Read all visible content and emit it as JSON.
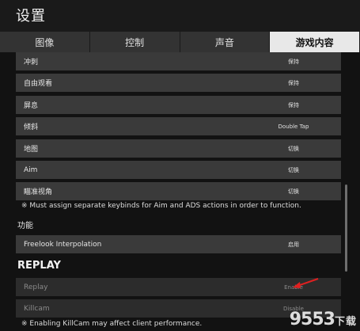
{
  "window": {
    "title": "设置"
  },
  "tabs": [
    {
      "label": "图像",
      "active": false
    },
    {
      "label": "控制",
      "active": false
    },
    {
      "label": "声音",
      "active": false
    },
    {
      "label": "游戏内容",
      "active": true
    }
  ],
  "rows": [
    {
      "label": "冲刺",
      "value": "保持"
    },
    {
      "label": "自由观看",
      "value": "保持"
    },
    {
      "label": "屏息",
      "value": "保持"
    },
    {
      "label": "倾斜",
      "value": "Double Tap"
    },
    {
      "label": "地图",
      "value": "切换"
    },
    {
      "label": "Aim",
      "value": "切换"
    },
    {
      "label": "瞄准视角",
      "value": "切换"
    }
  ],
  "notes": {
    "keybind": "※ Must assign separate keybinds for Aim and ADS actions in order to function.",
    "killcam": "※ Enabling KillCam may affect client performance."
  },
  "sections": {
    "features": "功能",
    "replay": "REPLAY"
  },
  "feature_rows": [
    {
      "label": "Freelook Interpolation",
      "value": "启用"
    }
  ],
  "replay_rows": [
    {
      "label": "Replay",
      "value": "Enable"
    },
    {
      "label": "Killcam",
      "value": "Disable"
    }
  ],
  "watermark": {
    "brand": "9553",
    "suffix": "下载"
  },
  "colors": {
    "active_tab": "#e8e8e8",
    "row_bg": "#3a3a3a",
    "annotation_arrow": "#e02020"
  }
}
